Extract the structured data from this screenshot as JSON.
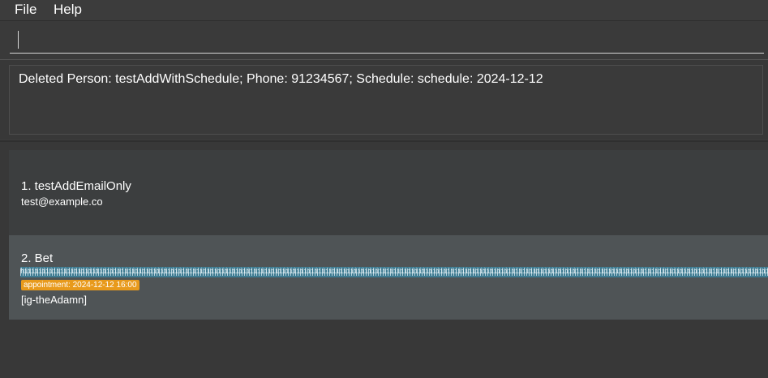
{
  "menu": {
    "file_label": "File",
    "help_label": "Help"
  },
  "command_box": {
    "value": "",
    "placeholder": ""
  },
  "result_display": {
    "message": "Deleted Person: testAddWithSchedule; Phone: 91234567; Schedule: schedule: 2024-12-12"
  },
  "person_list": [
    {
      "index_name": "1. testAddEmailOnly",
      "email": "test@example.co"
    },
    {
      "index_name": "2. Bet",
      "tag_text": "hiiiiiiiiiiiiiiiiiiiiiiiiiiiiiiiiiiiiiiiiiiiiiiiiiiiiiiiiiiiiiiiiiiiiiiiiiiiiiiiiiiiiiiiiiiiiiiiiiiiiiiiiiiiiiiiiiiiiiiiiiiiiiiiiiiiiiiiiiiiiiiiiiiiiiiiiiiiiiiiiiiiiiiiiiiiiiiiiiiiiiiiiiiiiiiiiiiiiiiiiiiiiiiiiiiiiiiiiiiiiiiiiiiiiiiiiiiiiiii",
      "appointment": "appointment: 2024-12-12 16:00",
      "social": "[ig-theAdamn]"
    }
  ],
  "colors": {
    "background": "#3c3c3c",
    "selected_card": "#4f5456",
    "tag": "#3e7b91",
    "appointment_badge": "#e89a1c"
  }
}
